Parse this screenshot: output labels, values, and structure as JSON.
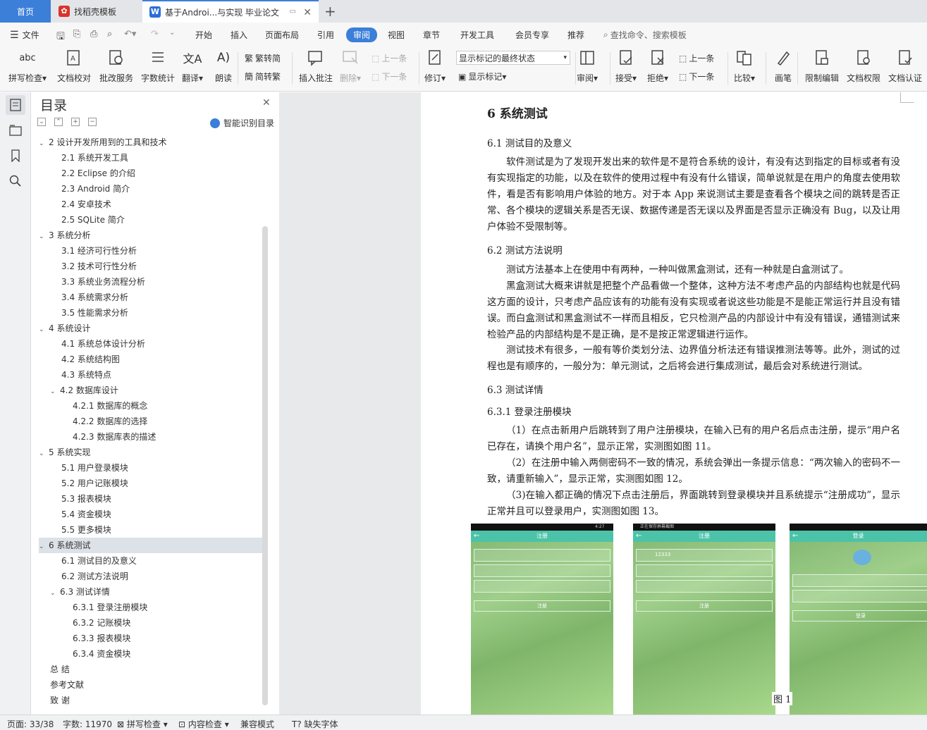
{
  "tabs": {
    "home": "首页",
    "template": "找稻壳模板",
    "doc": "基于Androi...与实现 毕业论文"
  },
  "menu": {
    "file": "文件",
    "items": [
      "开始",
      "插入",
      "页面布局",
      "引用",
      "审阅",
      "视图",
      "章节",
      "开发工具",
      "会员专享",
      "推荐"
    ],
    "search": "查找命令、搜索模板"
  },
  "ribbon": {
    "spell": "拼写检查",
    "proof": "文档校对",
    "batch": "批改服务",
    "count": "字数统计",
    "translate": "翻译",
    "read": "朗读",
    "to_trad": "繁转简",
    "to_simp": "简转繁",
    "insert_comment": "插入批注",
    "delete": "删除",
    "prev": "上一条",
    "next": "下一条",
    "revise": "修订",
    "markup_select": "显示标记的最终状态",
    "show_markup": "显示标记",
    "review": "审阅",
    "accept": "接受",
    "reject": "拒绝",
    "prev2": "上一条",
    "next2": "下一条",
    "compare": "比较",
    "pen": "画笔",
    "restrict": "限制编辑",
    "perm": "文档权限",
    "cert": "文档认证"
  },
  "toc": {
    "title": "目录",
    "smart": "智能识别目录",
    "items": [
      {
        "text": "2 设计开发所用到的工具和技术",
        "level": 1,
        "arrow": "⌄"
      },
      {
        "text": "2.1 系统开发工具",
        "level": 2
      },
      {
        "text": "2.2 Eclipse 的介绍",
        "level": 2
      },
      {
        "text": "2.3 Android 简介",
        "level": 2
      },
      {
        "text": "2.4 安卓技术",
        "level": 2
      },
      {
        "text": "2.5 SQLite 简介",
        "level": 2
      },
      {
        "text": "3 系统分析",
        "level": 1,
        "arrow": "⌄"
      },
      {
        "text": "3.1  经济可行性分析",
        "level": 2
      },
      {
        "text": "3.2  技术可行性分析",
        "level": 2
      },
      {
        "text": "3.3  系统业务流程分析",
        "level": 2
      },
      {
        "text": "3.4  系统需求分析",
        "level": 2
      },
      {
        "text": "3.5  性能需求分析",
        "level": 2
      },
      {
        "text": "4 系统设计",
        "level": 1,
        "arrow": "⌄"
      },
      {
        "text": "4.1 系统总体设计分析",
        "level": 2
      },
      {
        "text": "4.2 系统结构图",
        "level": 2
      },
      {
        "text": "4.3 系统特点",
        "level": 2
      },
      {
        "text": "4.2 数据库设计",
        "level": 2,
        "arrow": "⌄"
      },
      {
        "text": "4.2.1 数据库的概念",
        "level": 3
      },
      {
        "text": "4.2.2 数据库的选择",
        "level": 3
      },
      {
        "text": "4.2.3 数据库表的描述",
        "level": 3
      },
      {
        "text": "5 系统实现",
        "level": 1,
        "arrow": "⌄"
      },
      {
        "text": "5.1 用户登录模块",
        "level": 2
      },
      {
        "text": "5.2 用户记账模块",
        "level": 2
      },
      {
        "text": "5.3 报表模块",
        "level": 2
      },
      {
        "text": "5.4 资金模块",
        "level": 2
      },
      {
        "text": "5.5 更多模块",
        "level": 2
      },
      {
        "text": "6 系统测试",
        "level": 1,
        "arrow": "⌄",
        "selected": true
      },
      {
        "text": "6.1 测试目的及意义",
        "level": 2
      },
      {
        "text": "6.2 测试方法说明",
        "level": 2
      },
      {
        "text": "6.3 测试详情",
        "level": 2,
        "arrow": "⌄"
      },
      {
        "text": "6.3.1  登录注册模块",
        "level": 3
      },
      {
        "text": "6.3.2  记账模块",
        "level": 3
      },
      {
        "text": "6.3.3  报表模块",
        "level": 3
      },
      {
        "text": "6.3.4  资金模块",
        "level": 3
      },
      {
        "text": "总   结",
        "level": 1
      },
      {
        "text": "参考文献",
        "level": 1
      },
      {
        "text": "致   谢",
        "level": 1
      }
    ]
  },
  "doc": {
    "h1": "6 系统测试",
    "h61": "6.1 测试目的及意义",
    "p1": "软件测试是为了发现开发出来的软件是不是符合系统的设计，有没有达到指定的目标或者有没有实现指定的功能，以及在软件的使用过程中有没有什么错误，简单说就是在用户的角度去使用软件，看是否有影响用户体验的地方。对于本 App 来说测试主要是查看各个模块之间的跳转是否正常、各个模块的逻辑关系是否无误、数据传递是否无误以及界面是否显示正确没有 Bug，以及让用户体验不受限制等。",
    "h62": "6.2 测试方法说明",
    "p2": "测试方法基本上在使用中有两种，一种叫做黑盒测试，还有一种就是白盒测试了。",
    "p3": "黑盒测试大概来讲就是把整个产品看做一个整体，这种方法不考虑产品的内部结构也就是代码这方面的设计，只考虑产品应该有的功能有没有实现或者说这些功能是不是能正常运行并且没有错误。而白盒测试和黑盒测试不一样而且相反，它只检测产品的内部设计中有没有错误，通错测试来检验产品的内部结构是不是正确，是不是按正常逻辑进行运作。",
    "p4": "测试技术有很多，一般有等价类划分法、边界值分析法还有错误推测法等等。此外，测试的过程也是有顺序的，一般分为：单元测试，之后将会进行集成测试，最后会对系统进行测试。",
    "h63": "6.3 测试详情",
    "h631": "6.3.1  登录注册模块",
    "p5": "（1）在点击新用户后跳转到了用户注册模块，在输入已有的用户名后点击注册，提示“用户名已存在，请换个用户名”，显示正常，实测图如图 11。",
    "p6": "（2）在注册中输入两侧密码不一致的情况，系统会弹出一条提示信息：“两次输入的密码不一致，请重新输入”，显示正常，实测图如图 12。",
    "p7": "（3)在输入都正确的情况下点击注册后，界面跳转到登录模块并且系统提示“注册成功”，显示正常并且可以登录用户，实测图如图 13。",
    "caption": "图 1",
    "shot1": {
      "title": "注册",
      "time": "4:27",
      "button": "注册"
    },
    "shot2": {
      "title": "注册",
      "status": "正在保存屏幕截图",
      "field": "12333",
      "button": "注册"
    },
    "shot3": {
      "title": "登录",
      "button": "登录"
    }
  },
  "status": {
    "page": "页面: 33/38",
    "words": "字数: 11970",
    "spell": "拼写检查",
    "content": "内容检查",
    "compat": "兼容模式",
    "font": "缺失字体"
  },
  "colors": {
    "accent": "#3b7fd9",
    "header_green": "#4cc3a8"
  }
}
